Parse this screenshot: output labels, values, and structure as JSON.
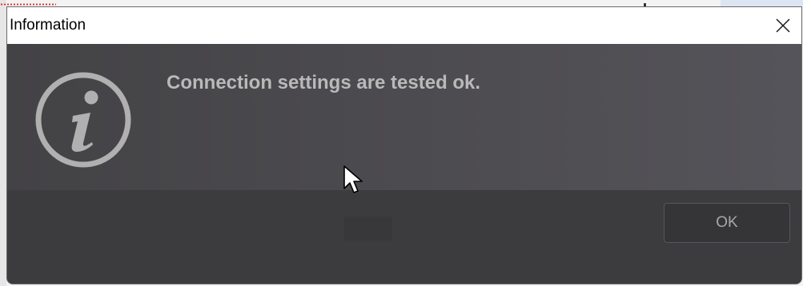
{
  "dialog": {
    "title": "Information",
    "message": "Connection settings are tested ok.",
    "ok_label": "OK"
  },
  "icons": {
    "close": "close-icon",
    "info": "info-icon",
    "cursor": "mouse-pointer-icon"
  },
  "colors": {
    "dialog_background": "#4b4a4e",
    "footer_background": "#3c3b3e",
    "titlebar_background": "#ffffff",
    "message_text": "#b9b9b9",
    "info_icon": "#b0b0b0"
  }
}
